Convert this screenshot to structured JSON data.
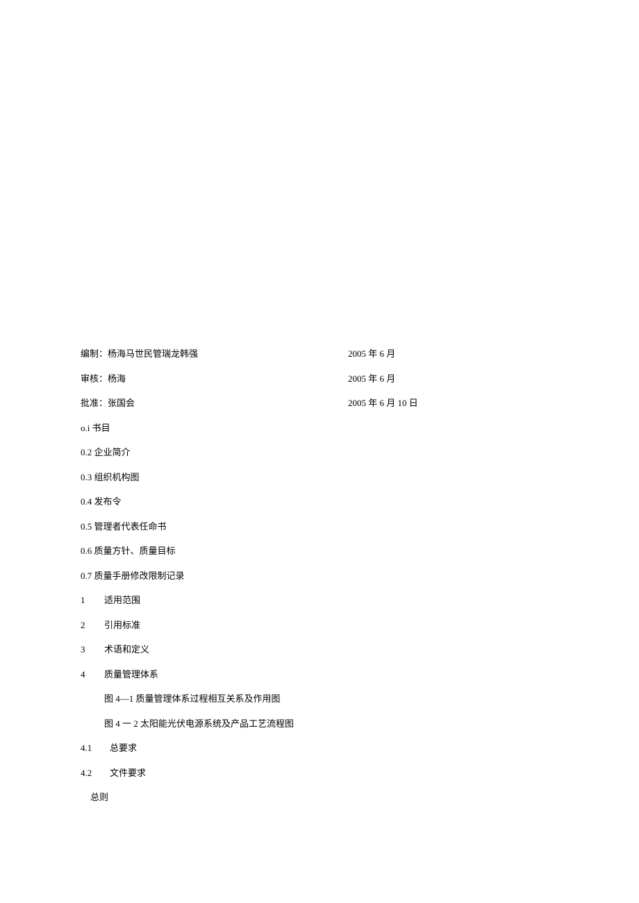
{
  "header": {
    "compiled_by_label": "编制：",
    "compiled_by_names": "杨海马世民管瑞龙韩强",
    "compiled_date": "2005 年 6 月",
    "reviewed_by_label": "审核：",
    "reviewed_by_names": "杨海",
    "reviewed_date": "2005 年 6 月",
    "approved_by_label": "批准：",
    "approved_by_names": "张国会",
    "approved_date": "2005 年 6 月 10 日"
  },
  "toc": {
    "item_0_1": "o.i 书目",
    "item_0_2": "0.2 企业简介",
    "item_0_3": "0.3 组织机构图",
    "item_0_4": "0.4 发布令",
    "item_0_5": "0.5 管理者代表任命书",
    "item_0_6": "0.6 质量方针、质量目标",
    "item_0_7": "0.7 质量手册修改限制记录",
    "num_1": "1",
    "label_1": "适用范围",
    "num_2": "2",
    "label_2": "引用标准",
    "num_3": "3",
    "label_3": "术语和定义",
    "num_4": "4",
    "label_4": "质量管理体系",
    "fig_4_1": "图 4—1 质量管理体系过程相互关系及作用图",
    "fig_4_2": "图 4 一 2 太阳能光伏电源系统及产品工艺流程图",
    "num_4_1": "4.1",
    "label_4_1": "总要求",
    "num_4_2": "4.2",
    "label_4_2": "文件要求",
    "final": "总则"
  }
}
